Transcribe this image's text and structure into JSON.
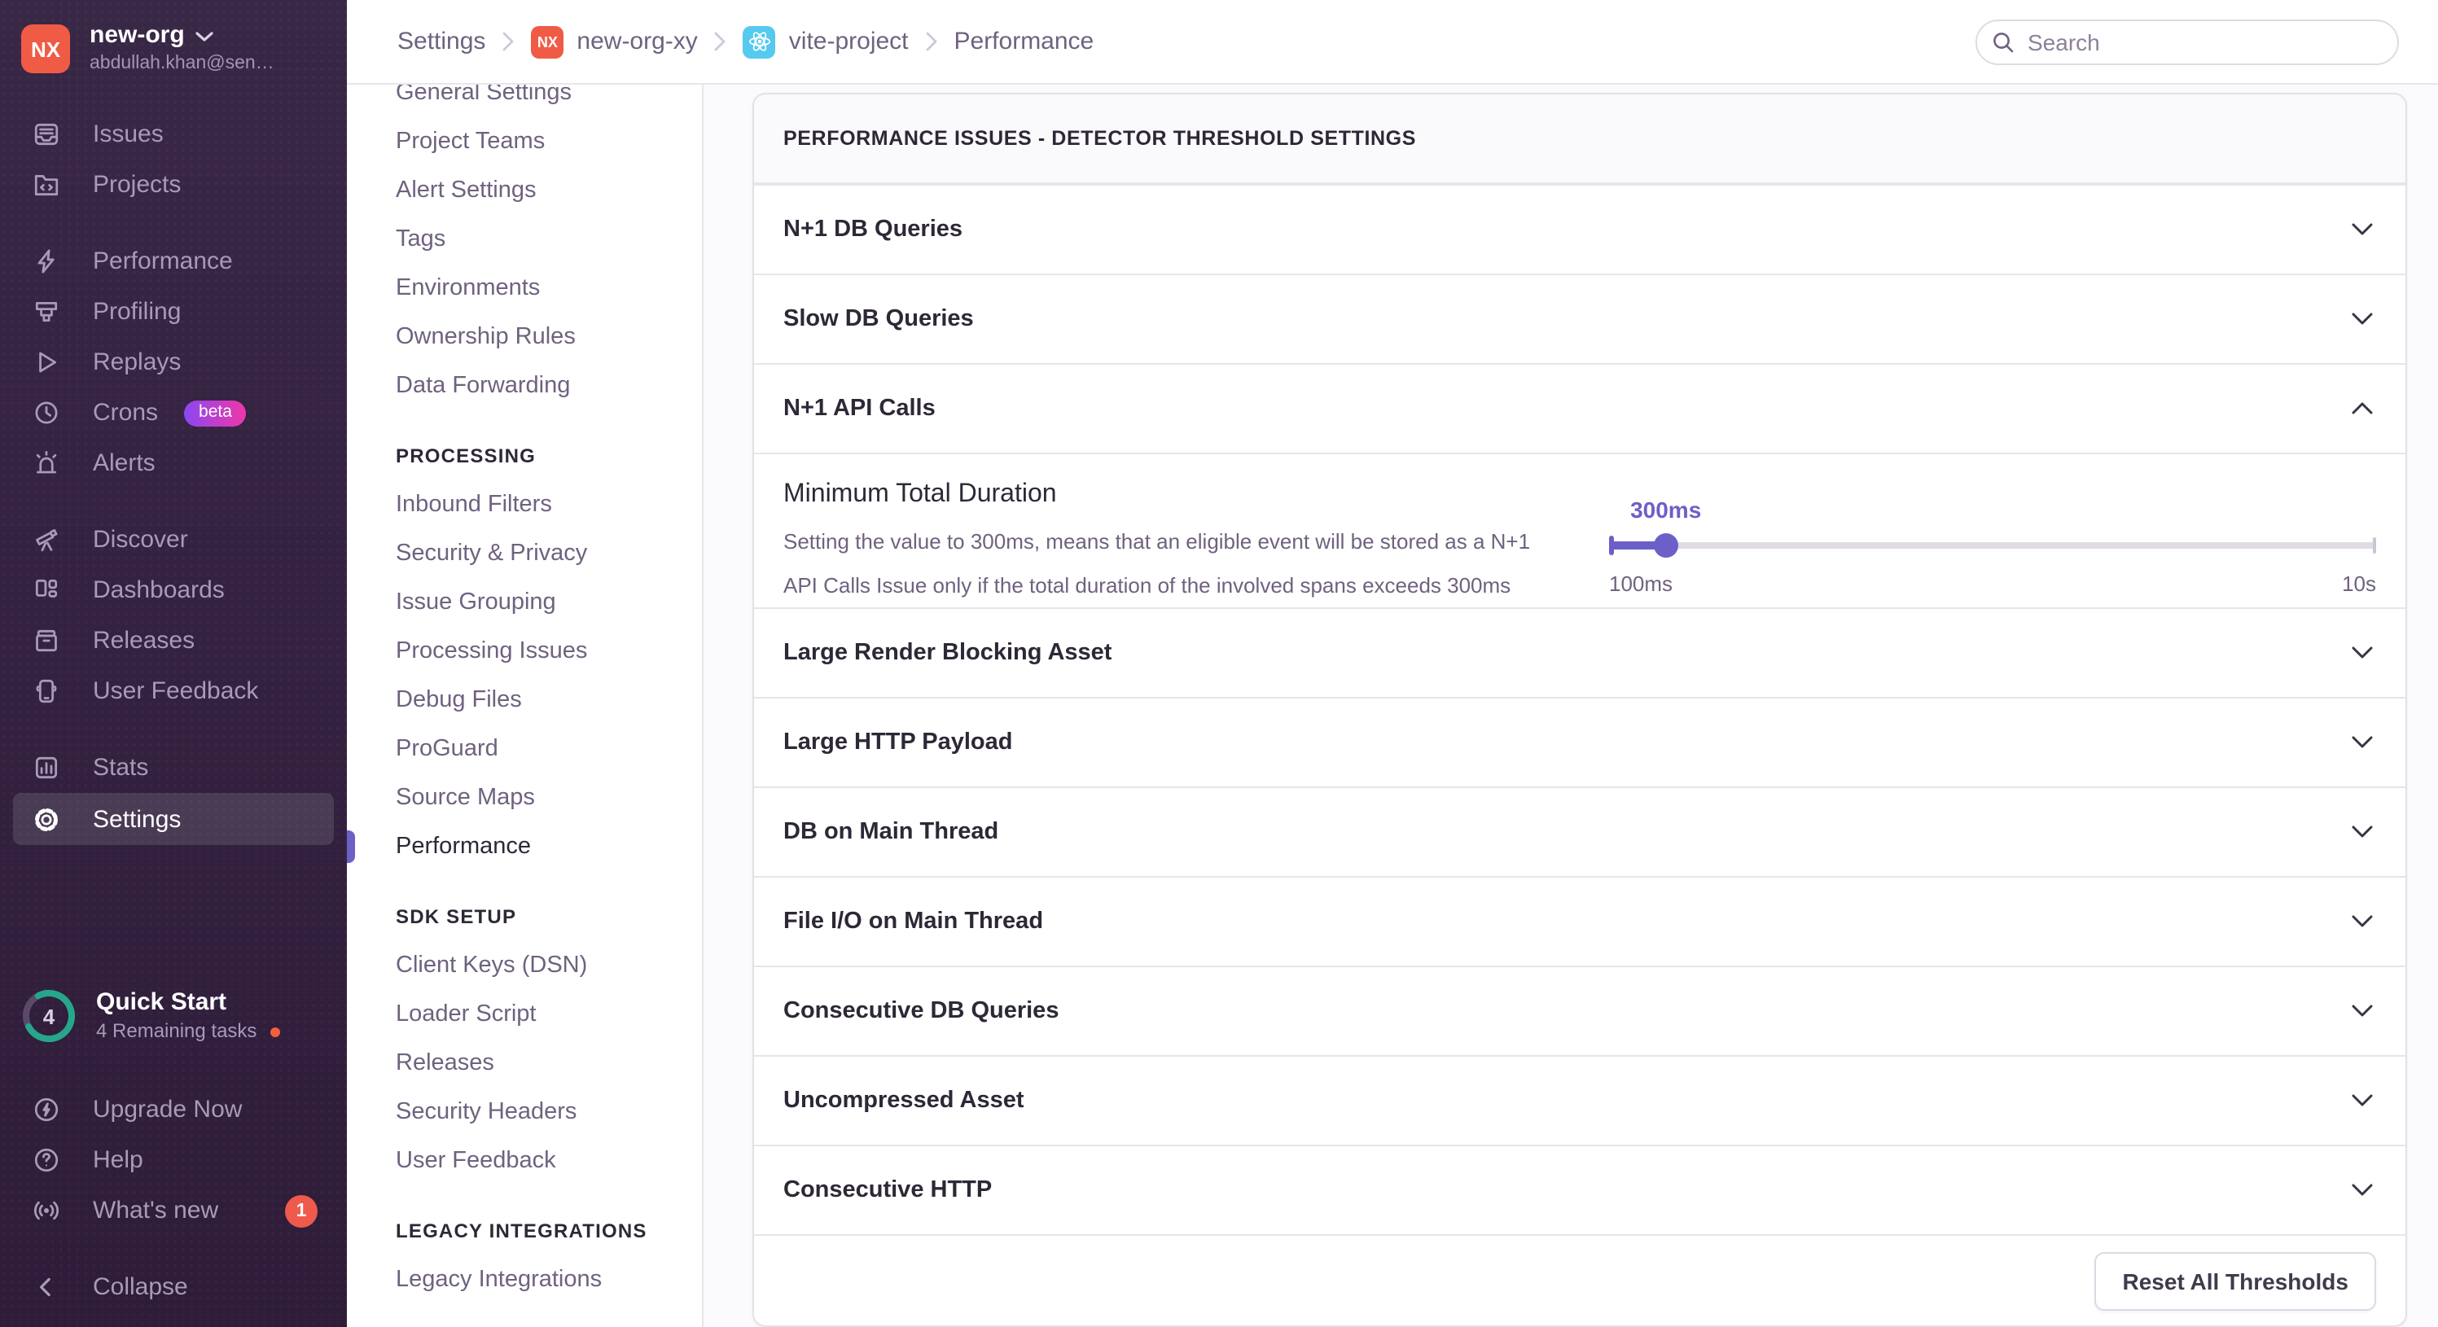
{
  "colors": {
    "accent": "#6C5FC7",
    "sidebar_bg": "#34203D",
    "avatar_red": "#EF5B45",
    "react_cyan": "#56C9EE",
    "badge_red": "#EF5A4C",
    "progress_teal": "#26A68B",
    "beta_gradient_from": "#8B47F2",
    "beta_gradient_to": "#EE38A8"
  },
  "org": {
    "initials": "NX",
    "name": "new-org",
    "email": "abdullah.khan@sen…"
  },
  "sidebar": {
    "items": {
      "issues": "Issues",
      "projects": "Projects",
      "performance": "Performance",
      "profiling": "Profiling",
      "replays": "Replays",
      "crons": "Crons",
      "crons_badge": "beta",
      "alerts": "Alerts",
      "discover": "Discover",
      "dashboards": "Dashboards",
      "releases": "Releases",
      "user_feedback": "User Feedback",
      "stats": "Stats",
      "settings": "Settings"
    },
    "quickstart": {
      "count": "4",
      "title": "Quick Start",
      "subtitle": "4 Remaining tasks"
    },
    "footer": {
      "upgrade": "Upgrade Now",
      "help": "Help",
      "whats_new": "What's new",
      "whats_new_badge": "1",
      "collapse": "Collapse"
    }
  },
  "header": {
    "breadcrumbs": {
      "settings": "Settings",
      "org_chip": "NX",
      "org": "new-org-xy",
      "project": "vite-project",
      "page": "Performance"
    },
    "search_placeholder": "Search"
  },
  "settingsNav": {
    "sections": [
      {
        "title": "",
        "items": [
          {
            "label": "General Settings"
          },
          {
            "label": "Project Teams"
          },
          {
            "label": "Alert Settings"
          },
          {
            "label": "Tags"
          },
          {
            "label": "Environments"
          },
          {
            "label": "Ownership Rules"
          },
          {
            "label": "Data Forwarding"
          }
        ]
      },
      {
        "title": "PROCESSING",
        "items": [
          {
            "label": "Inbound Filters"
          },
          {
            "label": "Security & Privacy"
          },
          {
            "label": "Issue Grouping"
          },
          {
            "label": "Processing Issues"
          },
          {
            "label": "Debug Files"
          },
          {
            "label": "ProGuard"
          },
          {
            "label": "Source Maps"
          },
          {
            "label": "Performance",
            "active": true
          }
        ]
      },
      {
        "title": "SDK SETUP",
        "items": [
          {
            "label": "Client Keys (DSN)"
          },
          {
            "label": "Loader Script"
          },
          {
            "label": "Releases"
          },
          {
            "label": "Security Headers"
          },
          {
            "label": "User Feedback"
          }
        ]
      },
      {
        "title": "LEGACY INTEGRATIONS",
        "items": [
          {
            "label": "Legacy Integrations"
          }
        ]
      }
    ]
  },
  "panel": {
    "title": "PERFORMANCE ISSUES - DETECTOR THRESHOLD SETTINGS",
    "rows_top": [
      {
        "label": "N+1 DB Queries"
      },
      {
        "label": "Slow DB Queries"
      }
    ],
    "expanded": {
      "label": "N+1 API Calls",
      "setting_label": "Minimum Total Duration",
      "description": "Setting the value to 300ms, means that an eligible event will be stored as a N+1 API Calls Issue only if the total duration of the involved spans exceeds 300ms",
      "slider": {
        "value_label": "300ms",
        "min_label": "100ms",
        "max_label": "10s",
        "percent": 7.4
      }
    },
    "rows_bottom": [
      {
        "label": "Large Render Blocking Asset"
      },
      {
        "label": "Large HTTP Payload"
      },
      {
        "label": "DB on Main Thread"
      },
      {
        "label": "File I/O on Main Thread"
      },
      {
        "label": "Consecutive DB Queries"
      },
      {
        "label": "Uncompressed Asset"
      },
      {
        "label": "Consecutive HTTP"
      }
    ],
    "reset_label": "Reset All Thresholds"
  }
}
